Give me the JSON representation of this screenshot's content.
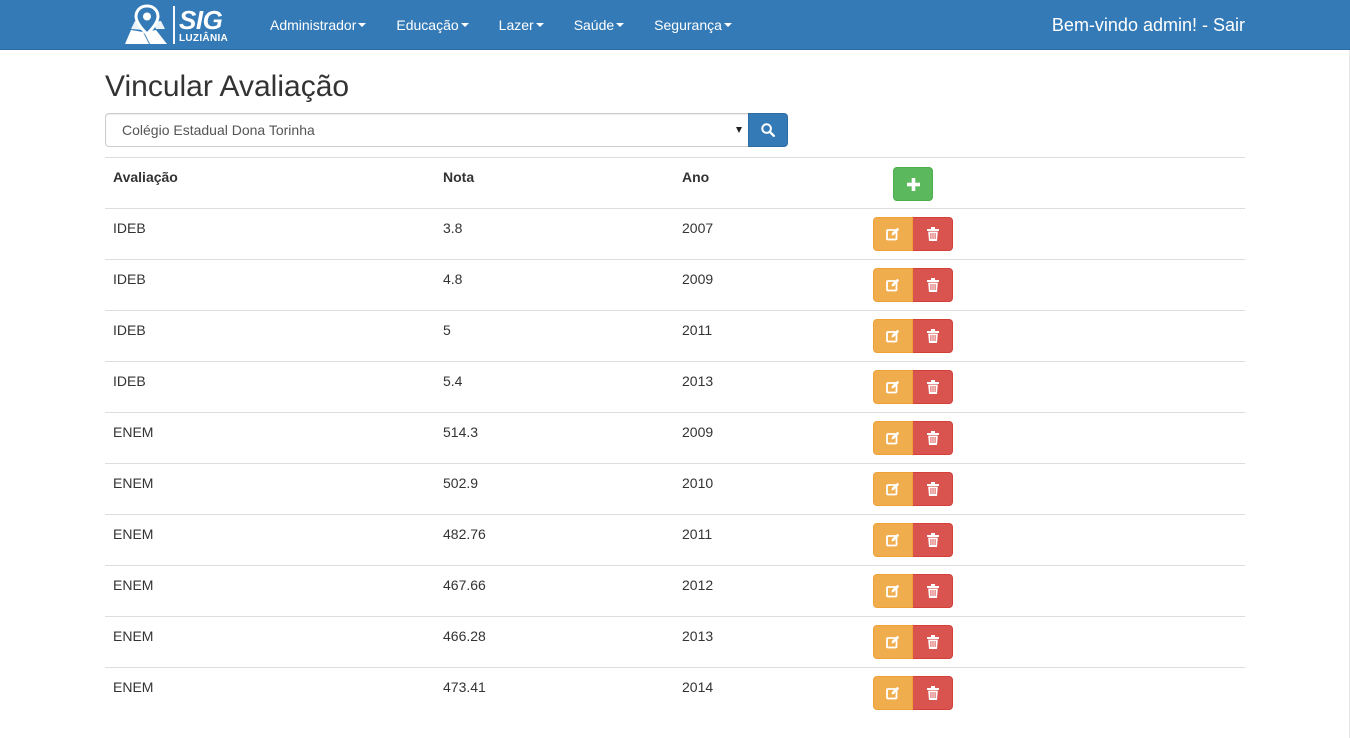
{
  "navbar": {
    "brand_title": "SIG",
    "brand_subtitle": "LUZIÂNIA",
    "menus": [
      {
        "label": "Administrador"
      },
      {
        "label": "Educação"
      },
      {
        "label": "Lazer"
      },
      {
        "label": "Saúde"
      },
      {
        "label": "Segurança"
      }
    ],
    "welcome": "Bem-vindo admin! - Sair",
    "color": "#337ab7"
  },
  "page": {
    "title": "Vincular Avaliação"
  },
  "school_select": {
    "selected": "Colégio Estadual Dona Torinha"
  },
  "table": {
    "headers": {
      "avaliacao": "Avaliação",
      "nota": "Nota",
      "ano": "Ano"
    },
    "rows": [
      {
        "avaliacao": "IDEB",
        "nota": "3.8",
        "ano": "2007"
      },
      {
        "avaliacao": "IDEB",
        "nota": "4.8",
        "ano": "2009"
      },
      {
        "avaliacao": "IDEB",
        "nota": "5",
        "ano": "2011"
      },
      {
        "avaliacao": "IDEB",
        "nota": "5.4",
        "ano": "2013"
      },
      {
        "avaliacao": "ENEM",
        "nota": "514.3",
        "ano": "2009"
      },
      {
        "avaliacao": "ENEM",
        "nota": "502.9",
        "ano": "2010"
      },
      {
        "avaliacao": "ENEM",
        "nota": "482.76",
        "ano": "2011"
      },
      {
        "avaliacao": "ENEM",
        "nota": "467.66",
        "ano": "2012"
      },
      {
        "avaliacao": "ENEM",
        "nota": "466.28",
        "ano": "2013"
      },
      {
        "avaliacao": "ENEM",
        "nota": "473.41",
        "ano": "2014"
      }
    ]
  },
  "icons": {
    "search": "search-icon",
    "add": "plus-icon",
    "edit": "edit-icon",
    "delete": "trash-icon"
  },
  "colors": {
    "primary": "#337ab7",
    "success": "#5cb85c",
    "warning": "#f0ad4e",
    "danger": "#d9534f"
  }
}
